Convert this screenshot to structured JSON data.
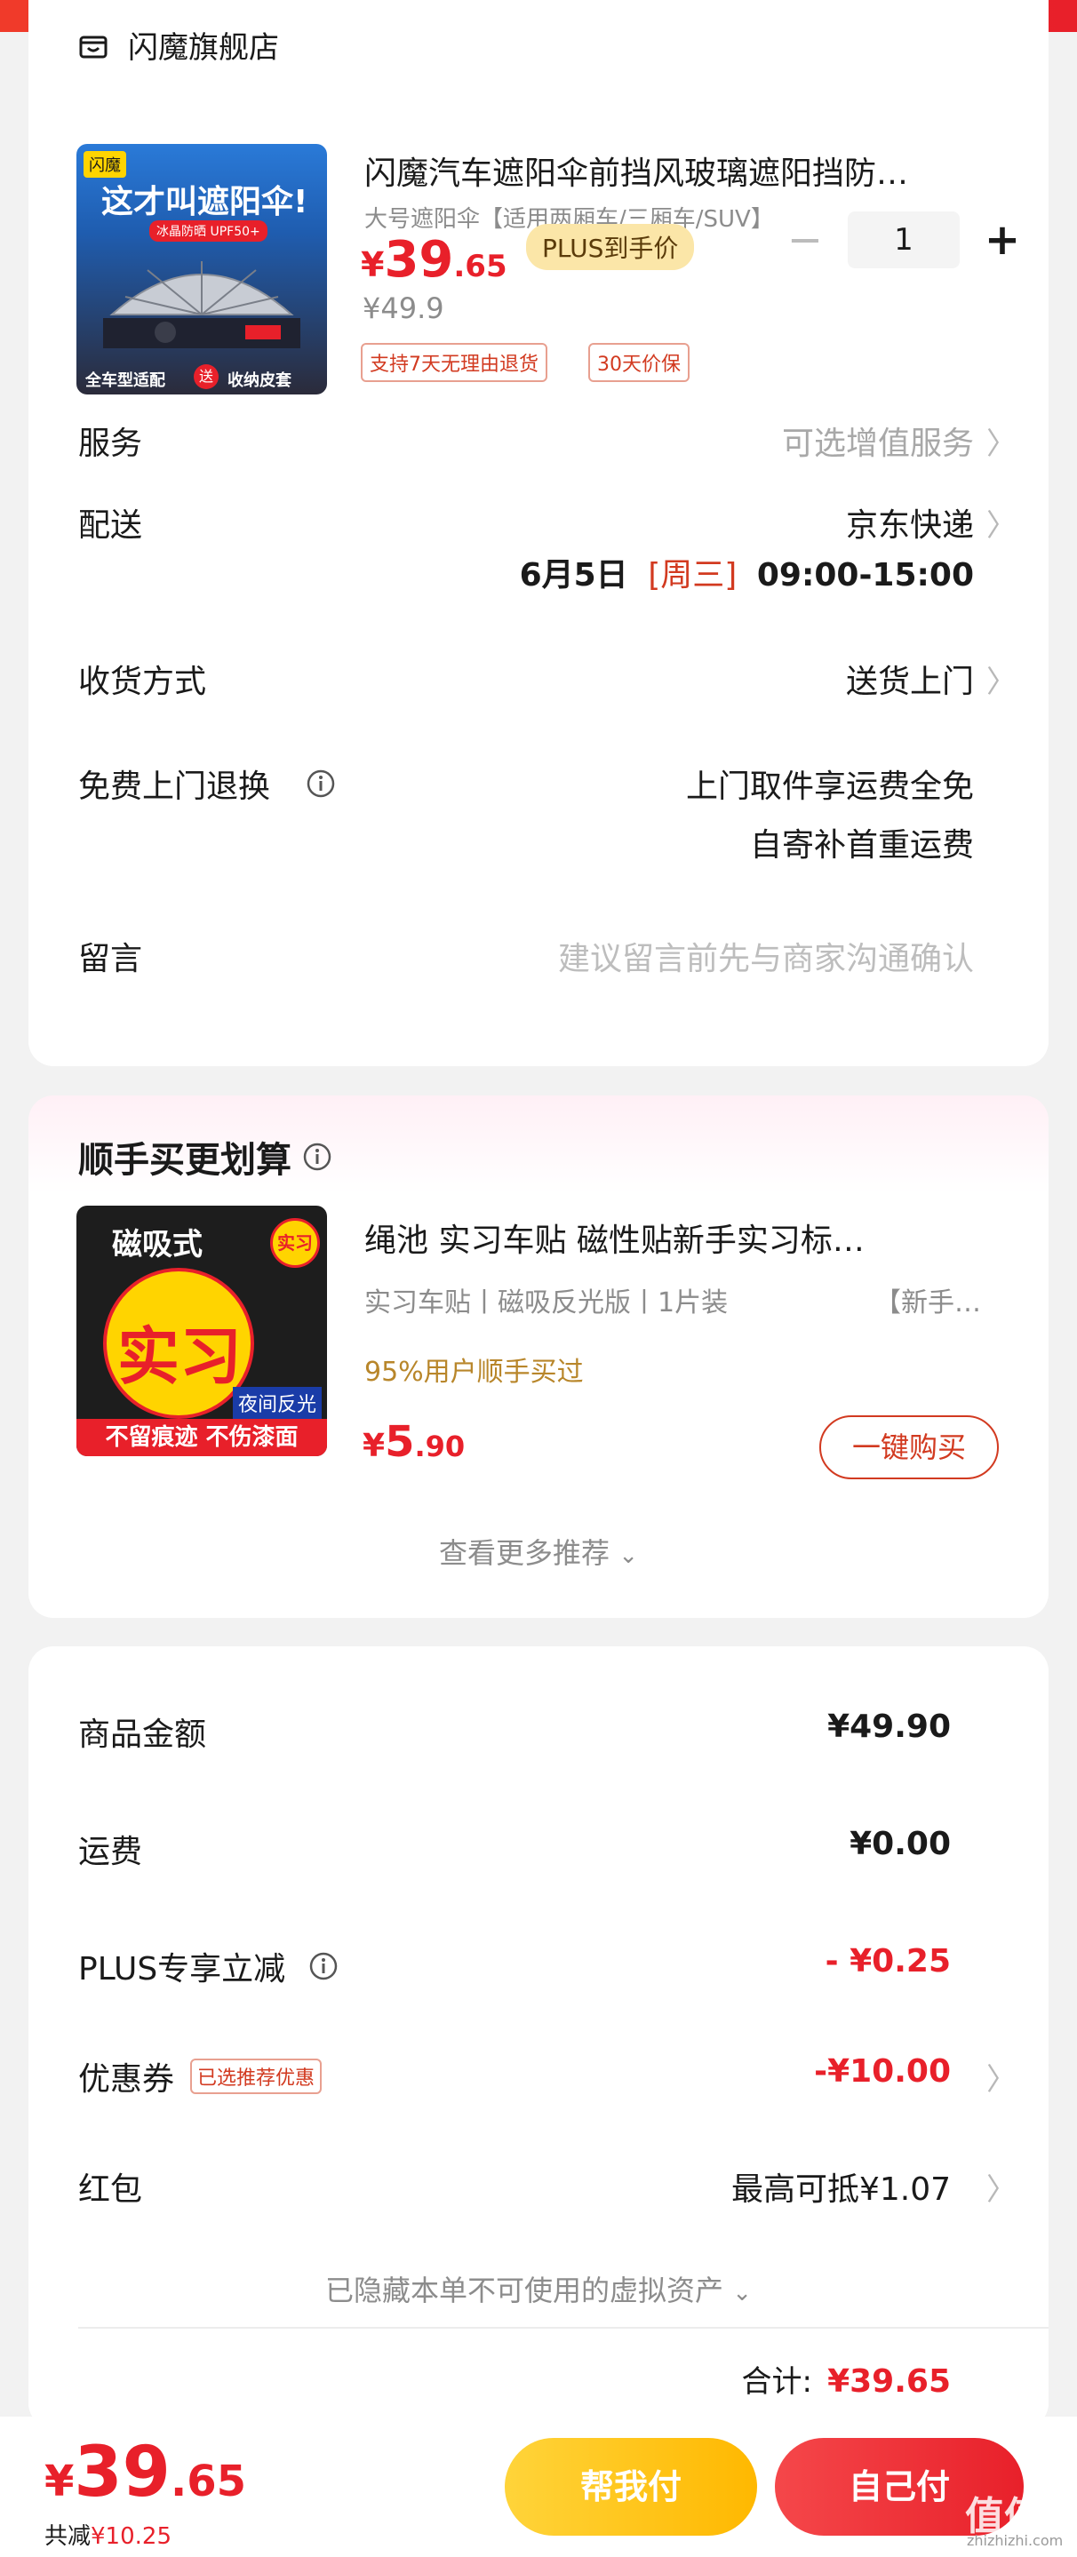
{
  "colors": {
    "accent_red": "#e8202a",
    "plus_gold": "#fbe6a8",
    "pay_yellow": "#ffc21a"
  },
  "store": {
    "name": "闪魔旗舰店",
    "icon": "store-icon"
  },
  "product": {
    "title": "闪魔汽车遮阳伞前挡风玻璃遮阳挡防…",
    "spec": "大号遮阳伞【适用两厢车/三厢车/SUV】",
    "thumb_badge": "闪魔",
    "thumb_slogan": "这才叫遮阳伞!",
    "thumb_sub": "冰晶防晒 UPF50+",
    "thumb_bottom_left": "全车型适配",
    "thumb_gift": "送",
    "thumb_bottom_right": "收纳皮套",
    "price_symbol": "¥",
    "price_int": "39",
    "price_dec": ".65",
    "plus_badge": "PLUS到手价",
    "original_price": "¥49.9",
    "tags": [
      "支持7天无理由退货",
      "30天价保"
    ],
    "quantity": "1",
    "qty_minus": "−",
    "qty_plus": "+"
  },
  "rows": {
    "service_label": "服务",
    "service_value": "可选增值服务",
    "delivery_label": "配送",
    "delivery_value": "京东快递",
    "delivery_date": "6月5日",
    "delivery_weekday": "[周三]",
    "delivery_time": "09:00-15:00",
    "receive_label": "收货方式",
    "receive_value": "送货上门",
    "return_label": "免费上门退换",
    "return_value": "上门取件享运费全免",
    "return_sub": "自寄补首重运费",
    "message_label": "留言",
    "message_placeholder": "建议留言前先与商家沟通确认",
    "chevron": "〉"
  },
  "addon": {
    "title": "顺手买更划算",
    "product_title": "绳池 实习车贴 磁性贴新手实习标…",
    "spec_1": "实习车贴丨磁吸反光版丨1片装",
    "spec_2": "【新手…",
    "social": "95%用户顺手买过",
    "price_symbol": "¥",
    "price_int": "5",
    "price_dec": ".90",
    "buy_label": "一键购买",
    "see_more": "查看更多推荐",
    "thumb_top": "磁吸式",
    "thumb_center": "实习",
    "thumb_corner": "实习",
    "thumb_night": "夜间反光",
    "thumb_bottom": "不留痕迹 不伤漆面"
  },
  "summary": {
    "goods_label": "商品金额",
    "goods_value": "¥49.90",
    "shipping_label": "运费",
    "shipping_value": "¥0.00",
    "plus_label": "PLUS专享立减",
    "plus_value": "- ¥0.25",
    "coupon_label": "优惠券",
    "coupon_tag": "已选推荐优惠",
    "coupon_value": "-¥10.00",
    "redpack_label": "红包",
    "redpack_value": "最高可抵¥1.07",
    "hidden_assets": "已隐藏本单不可使用的虚拟资产",
    "total_label": "合计:",
    "total_value": "¥39.65"
  },
  "bottom": {
    "price_symbol": "¥",
    "price_int": "39",
    "price_dec": ".65",
    "discount_label": "共减",
    "discount_value": "¥10.25",
    "pay_for_me": "帮我付",
    "pay_self": "自己付",
    "watermark": "值值值",
    "watermark_sub": "zhizhizhi.com"
  }
}
